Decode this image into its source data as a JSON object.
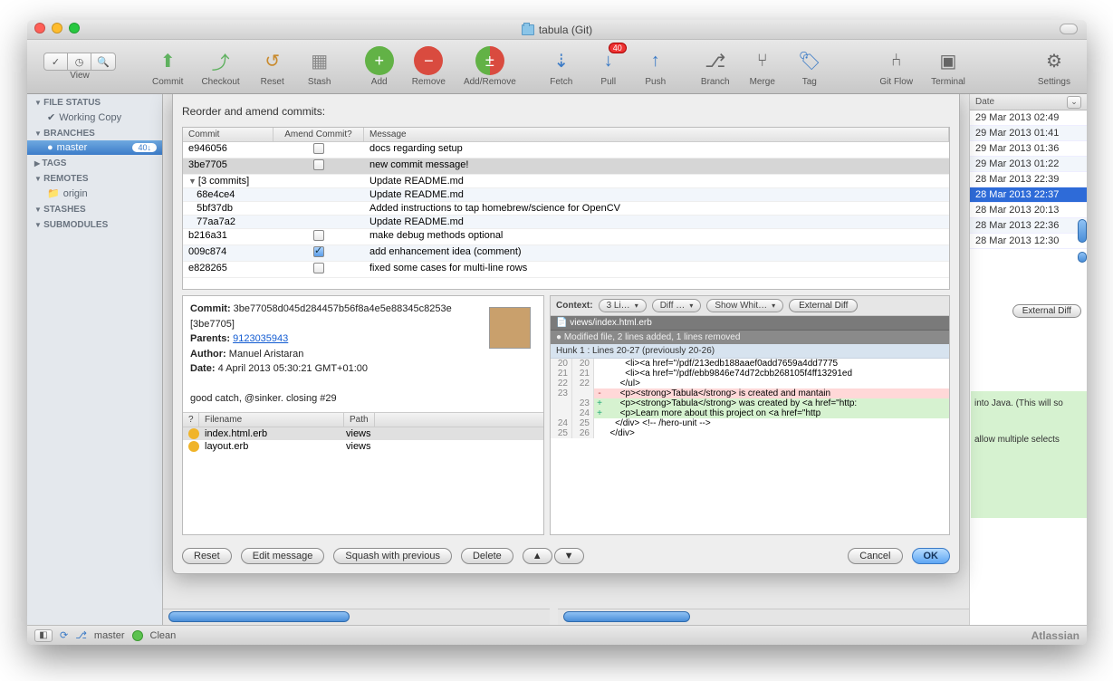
{
  "window": {
    "title": "tabula (Git)"
  },
  "toolbar": {
    "view": "View",
    "commit": "Commit",
    "checkout": "Checkout",
    "reset": "Reset",
    "stash": "Stash",
    "add": "Add",
    "remove": "Remove",
    "addremove": "Add/Remove",
    "fetch": "Fetch",
    "pull": "Pull",
    "push": "Push",
    "branch": "Branch",
    "merge": "Merge",
    "tag": "Tag",
    "gitflow": "Git Flow",
    "terminal": "Terminal",
    "settings": "Settings",
    "pull_badge": "40"
  },
  "sidebar": {
    "sections": [
      {
        "title": "FILE STATUS",
        "items": [
          {
            "label": "Working Copy",
            "icon": "check"
          }
        ]
      },
      {
        "title": "BRANCHES",
        "items": [
          {
            "label": "master",
            "count": "40↓",
            "sel": true
          }
        ]
      },
      {
        "title": "TAGS",
        "collapsed": true,
        "items": []
      },
      {
        "title": "REMOTES",
        "items": [
          {
            "label": "origin",
            "icon": "folder"
          }
        ]
      },
      {
        "title": "STASHES",
        "items": []
      },
      {
        "title": "SUBMODULES",
        "items": []
      }
    ]
  },
  "dateHeader": "Date",
  "dates": [
    "29 Mar 2013 02:49",
    "29 Mar 2013 01:41",
    "29 Mar 2013 01:36",
    "29 Mar 2013 01:22",
    "28 Mar 2013 22:39",
    "28 Mar 2013 22:37",
    "28 Mar 2013 20:13",
    "28 Mar 2013 22:36",
    "28 Mar 2013 12:30"
  ],
  "dateSelectedIndex": 5,
  "externalDiff": "External Diff",
  "bg_code": [
    "into Java. (This will so",
    "allow multiple selects"
  ],
  "sheet": {
    "title": "Reorder and amend commits:",
    "headers": {
      "commit": "Commit",
      "amend": "Amend Commit?",
      "message": "Message"
    },
    "rows": [
      {
        "sha": "e946056",
        "chk": false,
        "msg": "docs regarding setup"
      },
      {
        "sha": "3be7705",
        "chk": false,
        "msg": "new commit message!",
        "sel": true
      },
      {
        "sha": "[3 commits]",
        "group": true,
        "msg": "Update README.md"
      },
      {
        "sha": "68e4ce4",
        "child": true,
        "msg": "Update README.md"
      },
      {
        "sha": "5bf37db",
        "child": true,
        "msg": "Added instructions to tap homebrew/science for OpenCV"
      },
      {
        "sha": "77aa7a2",
        "child": true,
        "msg": "Update README.md"
      },
      {
        "sha": "b216a31",
        "chk": false,
        "msg": "make debug methods optional"
      },
      {
        "sha": "009c874",
        "chk": true,
        "msg": "add enhancement idea (comment)"
      },
      {
        "sha": "e828265",
        "chk": false,
        "msg": "fixed some cases for multi-line rows"
      }
    ],
    "meta": {
      "commitLabel": "Commit:",
      "commit": "3be77058d045d284457b56f8a4e5e88345c8253e [3be7705]",
      "parentsLabel": "Parents:",
      "parents": "9123035943",
      "authorLabel": "Author:",
      "author": "Manuel Aristaran",
      "dateLabel": "Date:",
      "date": "4 April 2013 05:30:21 GMT+01:00",
      "subject": "good catch, @sinker. closing #29"
    },
    "fileHeaders": {
      "q": "?",
      "name": "Filename",
      "path": "Path"
    },
    "files": [
      {
        "name": "index.html.erb",
        "path": "views",
        "sel": true
      },
      {
        "name": "layout.erb",
        "path": "views"
      }
    ],
    "context": {
      "label": "Context:",
      "lines": "3 Li…",
      "diff": "Diff …",
      "ws": "Show Whit…",
      "ext": "External Diff"
    },
    "diff": {
      "file": "views/index.html.erb",
      "summary": "Modified file, 2 lines added, 1 lines removed",
      "hunk": "Hunk 1 : Lines 20-27 (previously 20-26)",
      "lines": [
        {
          "ol": "20",
          "nl": "20",
          "t": " ",
          "c": "        <li><a href=\"/pdf/213edb188aaef0add7659a4dd7775"
        },
        {
          "ol": "21",
          "nl": "21",
          "t": " ",
          "c": "        <li><a href=\"/pdf/ebb9846e74d72cbb268105f4ff13291ed"
        },
        {
          "ol": "22",
          "nl": "22",
          "t": " ",
          "c": "      </ul>"
        },
        {
          "ol": "23",
          "nl": "",
          "t": "-",
          "c": "      <p><strong>Tabula</strong> is created and mantain"
        },
        {
          "ol": "",
          "nl": "23",
          "t": "+",
          "c": "      <p><strong>Tabula</strong> was created by <a href=\"http:"
        },
        {
          "ol": "",
          "nl": "24",
          "t": "+",
          "c": "      <p>Learn more about this project on <a href=\"http"
        },
        {
          "ol": "24",
          "nl": "25",
          "t": " ",
          "c": "    </div> <!-- /hero-unit -->"
        },
        {
          "ol": "25",
          "nl": "26",
          "t": " ",
          "c": "  </div>"
        }
      ]
    },
    "buttons": {
      "reset": "Reset",
      "edit": "Edit message",
      "squash": "Squash with previous",
      "delete": "Delete",
      "up": "▲",
      "down": "▼",
      "cancel": "Cancel",
      "ok": "OK"
    }
  },
  "status": {
    "branch": "master",
    "state": "Clean",
    "brand": "Atlassian"
  }
}
